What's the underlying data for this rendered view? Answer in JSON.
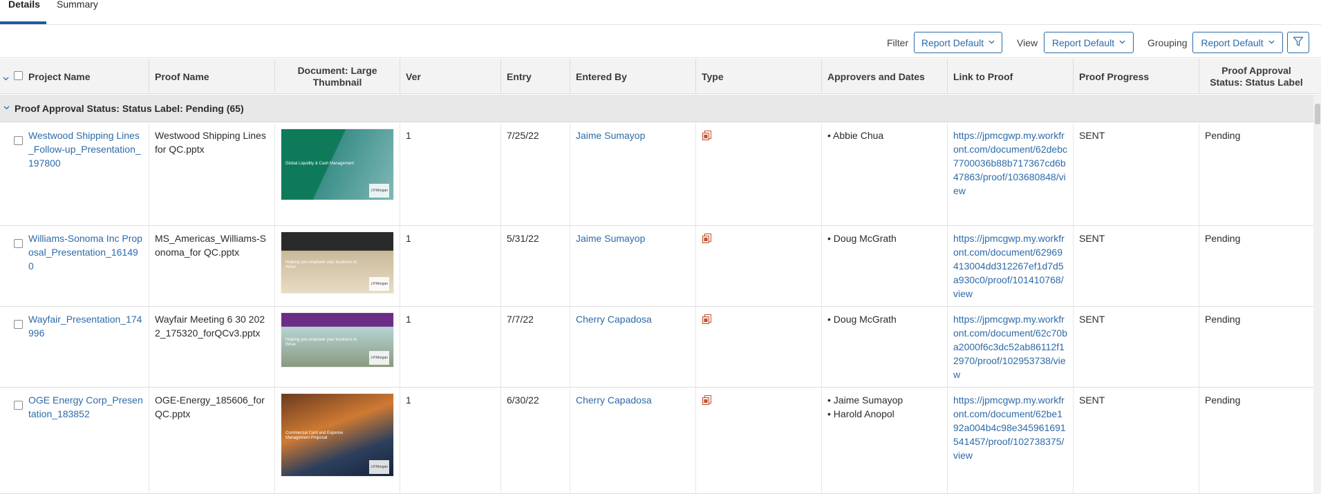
{
  "tabs": [
    {
      "label": "Details",
      "active": true
    },
    {
      "label": "Summary",
      "active": false
    }
  ],
  "toolbar": {
    "filter_label": "Filter",
    "filter_value": "Report Default",
    "view_label": "View",
    "view_value": "Report Default",
    "grouping_label": "Grouping",
    "grouping_value": "Report Default"
  },
  "columns": [
    "Project Name",
    "Proof Name",
    "Document: Large Thumbnail",
    "Ver",
    "Entry",
    "Entered By",
    "Type",
    "Approvers and Dates",
    "Link to Proof",
    "Proof Progress",
    "Proof Approval Status: Status Label"
  ],
  "group": {
    "label": "Proof Approval Status: Status Label: Pending (65)"
  },
  "rows": [
    {
      "project": "Westwood Shipping Lines_Follow-up_Presentation_197800",
      "proof": "Westwood Shipping Lines for QC.pptx",
      "ver": "1",
      "entry": "7/25/22",
      "entered_by": "Jaime Sumayop",
      "approvers": [
        "Abbie Chua"
      ],
      "link": "https://jpmcgwp.my.workfront.com/document/62debc7700036b88b717367cd6b47863/proof/103680848/view",
      "progress": "SENT",
      "status": "Pending",
      "thumb": {
        "title": "Global Liquidity & Cash Management",
        "brand": "J.P.Morgan"
      }
    },
    {
      "project": "Williams-Sonoma Inc Proposal_Presentation_161490",
      "proof": "MS_Americas_Williams-Sonoma_for QC.pptx",
      "ver": "1",
      "entry": "5/31/22",
      "entered_by": "Jaime Sumayop",
      "approvers": [
        "Doug McGrath"
      ],
      "link": "https://jpmcgwp.my.workfront.com/document/62969413004dd312267ef1d7d5a930c0/proof/101410768/view",
      "progress": "SENT",
      "status": "Pending",
      "thumb": {
        "title": "Helping you empower your business to thrive",
        "brand": "J.P.Morgan"
      }
    },
    {
      "project": "Wayfair_Presentation_174996",
      "proof": "Wayfair Meeting 6 30 2022_175320_forQCv3.pptx",
      "ver": "1",
      "entry": "7/7/22",
      "entered_by": "Cherry Capadosa",
      "approvers": [
        "Doug McGrath"
      ],
      "link": "https://jpmcgwp.my.workfront.com/document/62c70ba2000f6c3dc52ab86112f12970/proof/102953738/view",
      "progress": "SENT",
      "status": "Pending",
      "thumb": {
        "title": "Helping you empower your business to thrive",
        "brand": "J.P.Morgan"
      }
    },
    {
      "project": "OGE Energy Corp_Presentation_183852",
      "proof": "OGE-Energy_185606_forQC.pptx",
      "ver": "1",
      "entry": "6/30/22",
      "entered_by": "Cherry Capadosa",
      "approvers": [
        "Jaime Sumayop",
        "Harold Anopol"
      ],
      "link": "https://jpmcgwp.my.workfront.com/document/62be192a004b4c98e345961691541457/proof/102738375/view",
      "progress": "SENT",
      "status": "Pending",
      "thumb": {
        "title": "Commercial Card and Expense Management Proposal",
        "brand": "J.P.Morgan"
      }
    }
  ],
  "colors": {
    "accent": "#2d6aa8",
    "tab_underline": "#1f5aa0",
    "header_bg": "#f3f3f3",
    "group_bg": "#e8e8e8"
  },
  "icons": [
    "chevron-down-icon",
    "filter-icon",
    "document-proof-icon"
  ]
}
